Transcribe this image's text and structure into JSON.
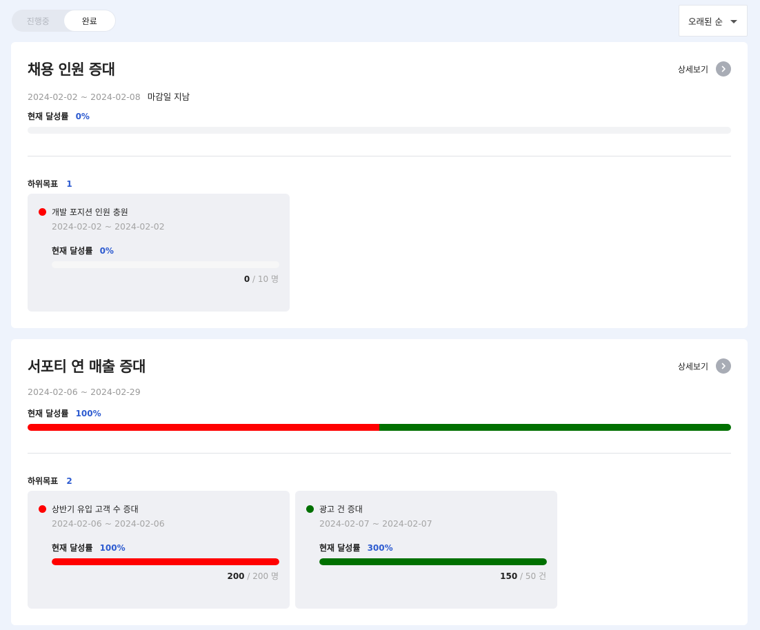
{
  "tabs": {
    "in_progress": "진행중",
    "done": "완료"
  },
  "sort": {
    "label": "오래된 순"
  },
  "goals": [
    {
      "title": "채용 인원 증대",
      "detail_label": "상세보기",
      "period": "2024-02-02 ~ 2024-02-08",
      "status": "마감일 지남",
      "rate_label": "현재 달성률",
      "rate_value": "0%",
      "progress": 0,
      "sub_label": "하위목표",
      "sub_count": "1",
      "subgoals": [
        {
          "name": "개발 포지션 인원 충원",
          "period": "2024-02-02 ~ 2024-02-02",
          "rate_label": "현재 달성률",
          "rate_value": "0%",
          "progress": 0,
          "color": "#ff0000",
          "current": "0",
          "total": "/ 10 명"
        }
      ]
    },
    {
      "title": "서포티 연 매출 증대",
      "detail_label": "상세보기",
      "period": "2024-02-06 ~ 2024-02-29",
      "status": "",
      "rate_label": "현재 달성률",
      "rate_value": "100%",
      "progress": 100,
      "segments": [
        {
          "color": "#ff0000",
          "share": 0.5
        },
        {
          "color": "#007000",
          "share": 0.5
        }
      ],
      "sub_label": "하위목표",
      "sub_count": "2",
      "subgoals": [
        {
          "name": "상반기 유입 고객 수 증대",
          "period": "2024-02-06 ~ 2024-02-06",
          "rate_label": "현재 달성률",
          "rate_value": "100%",
          "progress": 100,
          "color": "#ff0000",
          "current": "200",
          "total": "/ 200 명"
        },
        {
          "name": "광고 건 증대",
          "period": "2024-02-07 ~ 2024-02-07",
          "rate_label": "현재 달성률",
          "rate_value": "300%",
          "progress": 100,
          "color": "#007000",
          "current": "150",
          "total": "/ 50 건"
        }
      ]
    }
  ]
}
